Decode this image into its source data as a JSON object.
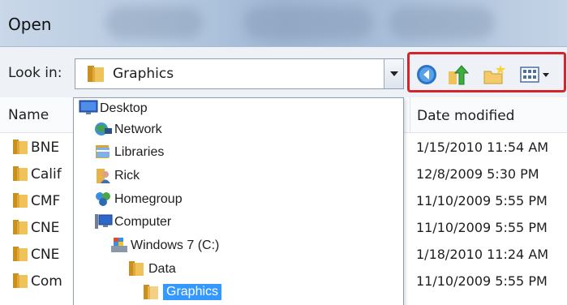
{
  "window": {
    "title": "Open"
  },
  "toolbar": {
    "lookin_label": "Look in:",
    "lookin_value": "Graphics"
  },
  "headers": {
    "name": "Name",
    "date": "Date modified"
  },
  "files": [
    {
      "name": "BNE",
      "date": "1/15/2010 11:54 AM"
    },
    {
      "name": "Calif",
      "date": "12/8/2009 5:30 PM"
    },
    {
      "name": "CMF",
      "date": "11/10/2009 5:55 PM"
    },
    {
      "name": "CNE",
      "date": "11/10/2009 5:55 PM"
    },
    {
      "name": "CNE",
      "date": "1/18/2010 11:24 AM"
    },
    {
      "name": "Com",
      "date": "11/10/2009 5:55 PM"
    }
  ],
  "dropdown": [
    {
      "label": "Desktop",
      "icon": "desktop-icon"
    },
    {
      "label": "Network",
      "icon": "network-icon"
    },
    {
      "label": "Libraries",
      "icon": "libraries-icon"
    },
    {
      "label": "Rick",
      "icon": "user-icon"
    },
    {
      "label": "Homegroup",
      "icon": "homegroup-icon"
    },
    {
      "label": "Computer",
      "icon": "computer-icon"
    },
    {
      "label": "Windows 7 (C:)",
      "icon": "drive-icon"
    },
    {
      "label": "Data",
      "icon": "folder-icon"
    },
    {
      "label": "Graphics",
      "icon": "folder-open-icon",
      "selected": true
    }
  ],
  "colors": {
    "highlight": "#3399ff",
    "nav_box": "#d3262c",
    "folder": "#e8b84a"
  }
}
